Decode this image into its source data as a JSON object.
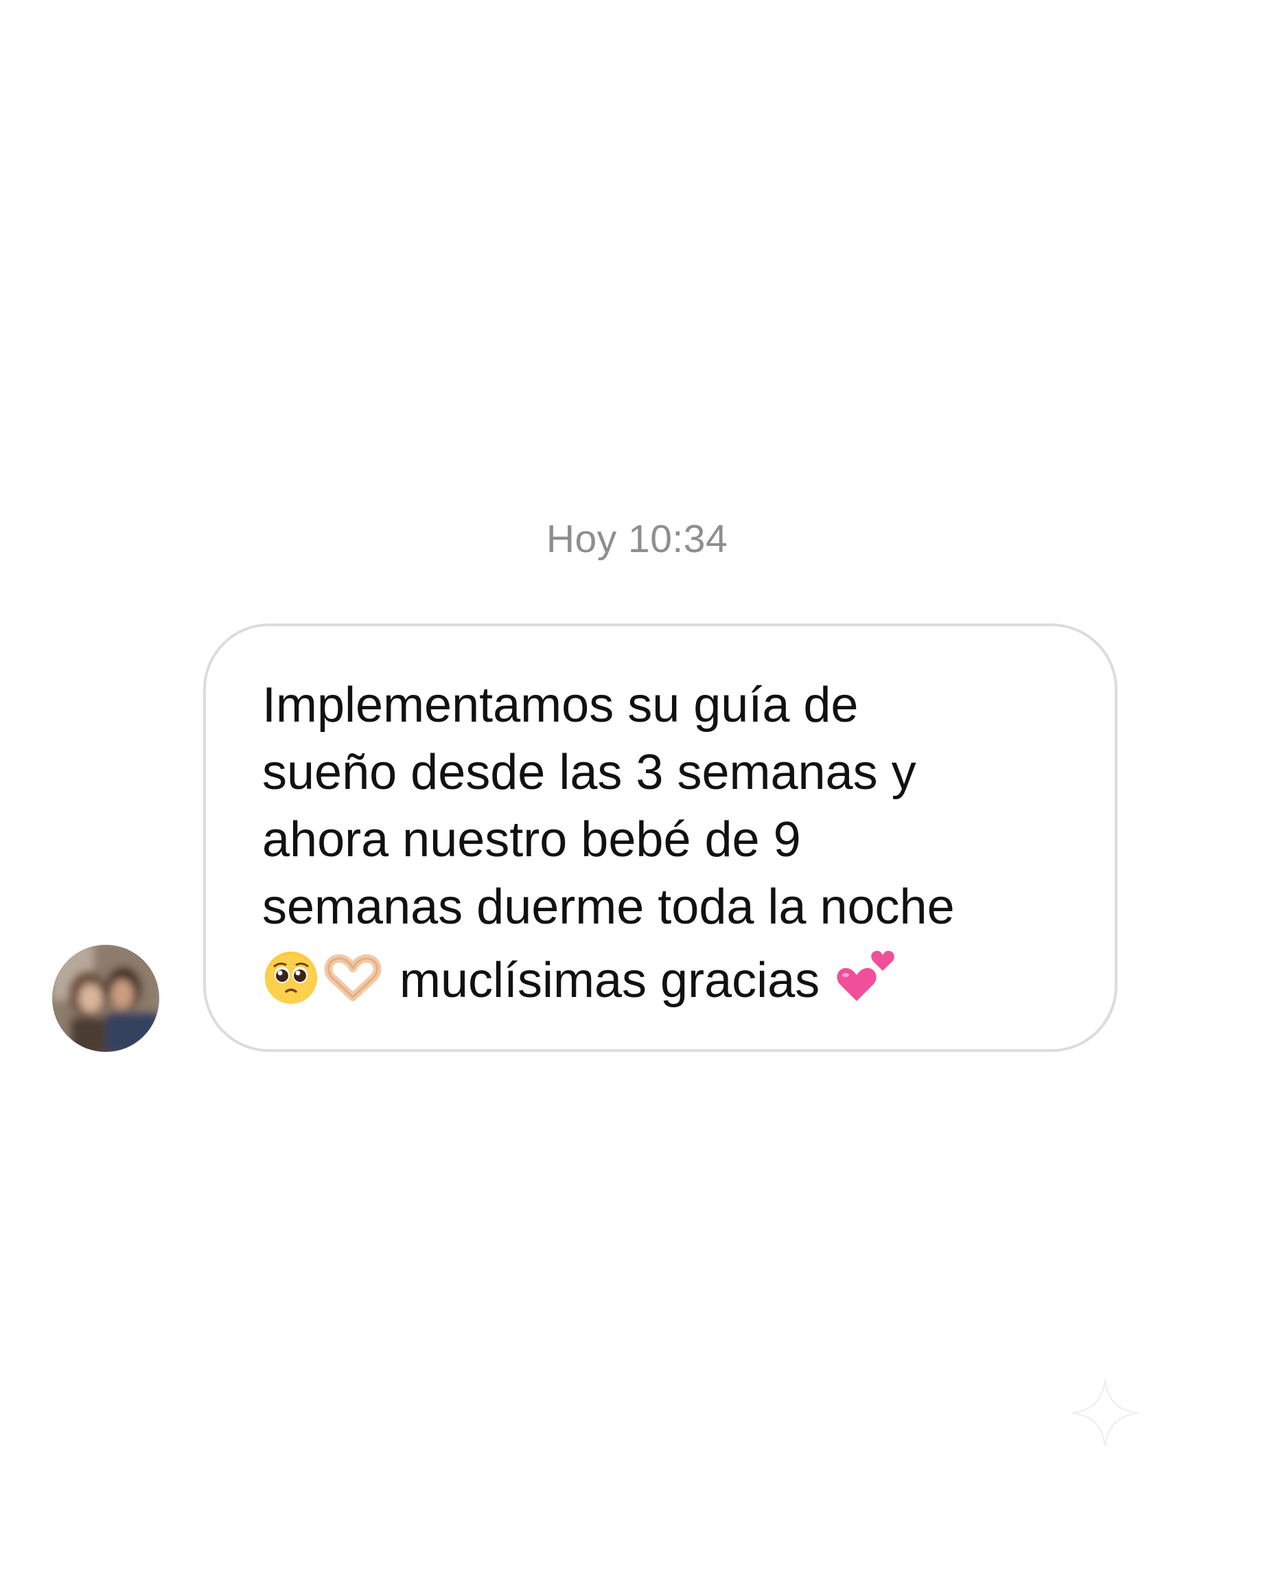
{
  "conversation": {
    "timestamp": "Hoy 10:34",
    "message": {
      "line1": "Implementamos su guía de",
      "line2": "sueño desde las 3 semanas y",
      "line3": "ahora nuestro bebé de 9",
      "line4": "semanas duerme toda la noche",
      "line5_text": " muclísimas gracias ",
      "emojis": [
        "pleading-face",
        "heart-hands",
        "two-hearts"
      ]
    },
    "sender_avatar": "blurred-profile-photo"
  },
  "colors": {
    "background": "#ffffff",
    "bubble_border": "#dcdcdc",
    "timestamp": "#8e8e8e",
    "text": "#111111",
    "heart": "#f0509a"
  },
  "icons": {
    "decoration": "sparkle-icon"
  }
}
